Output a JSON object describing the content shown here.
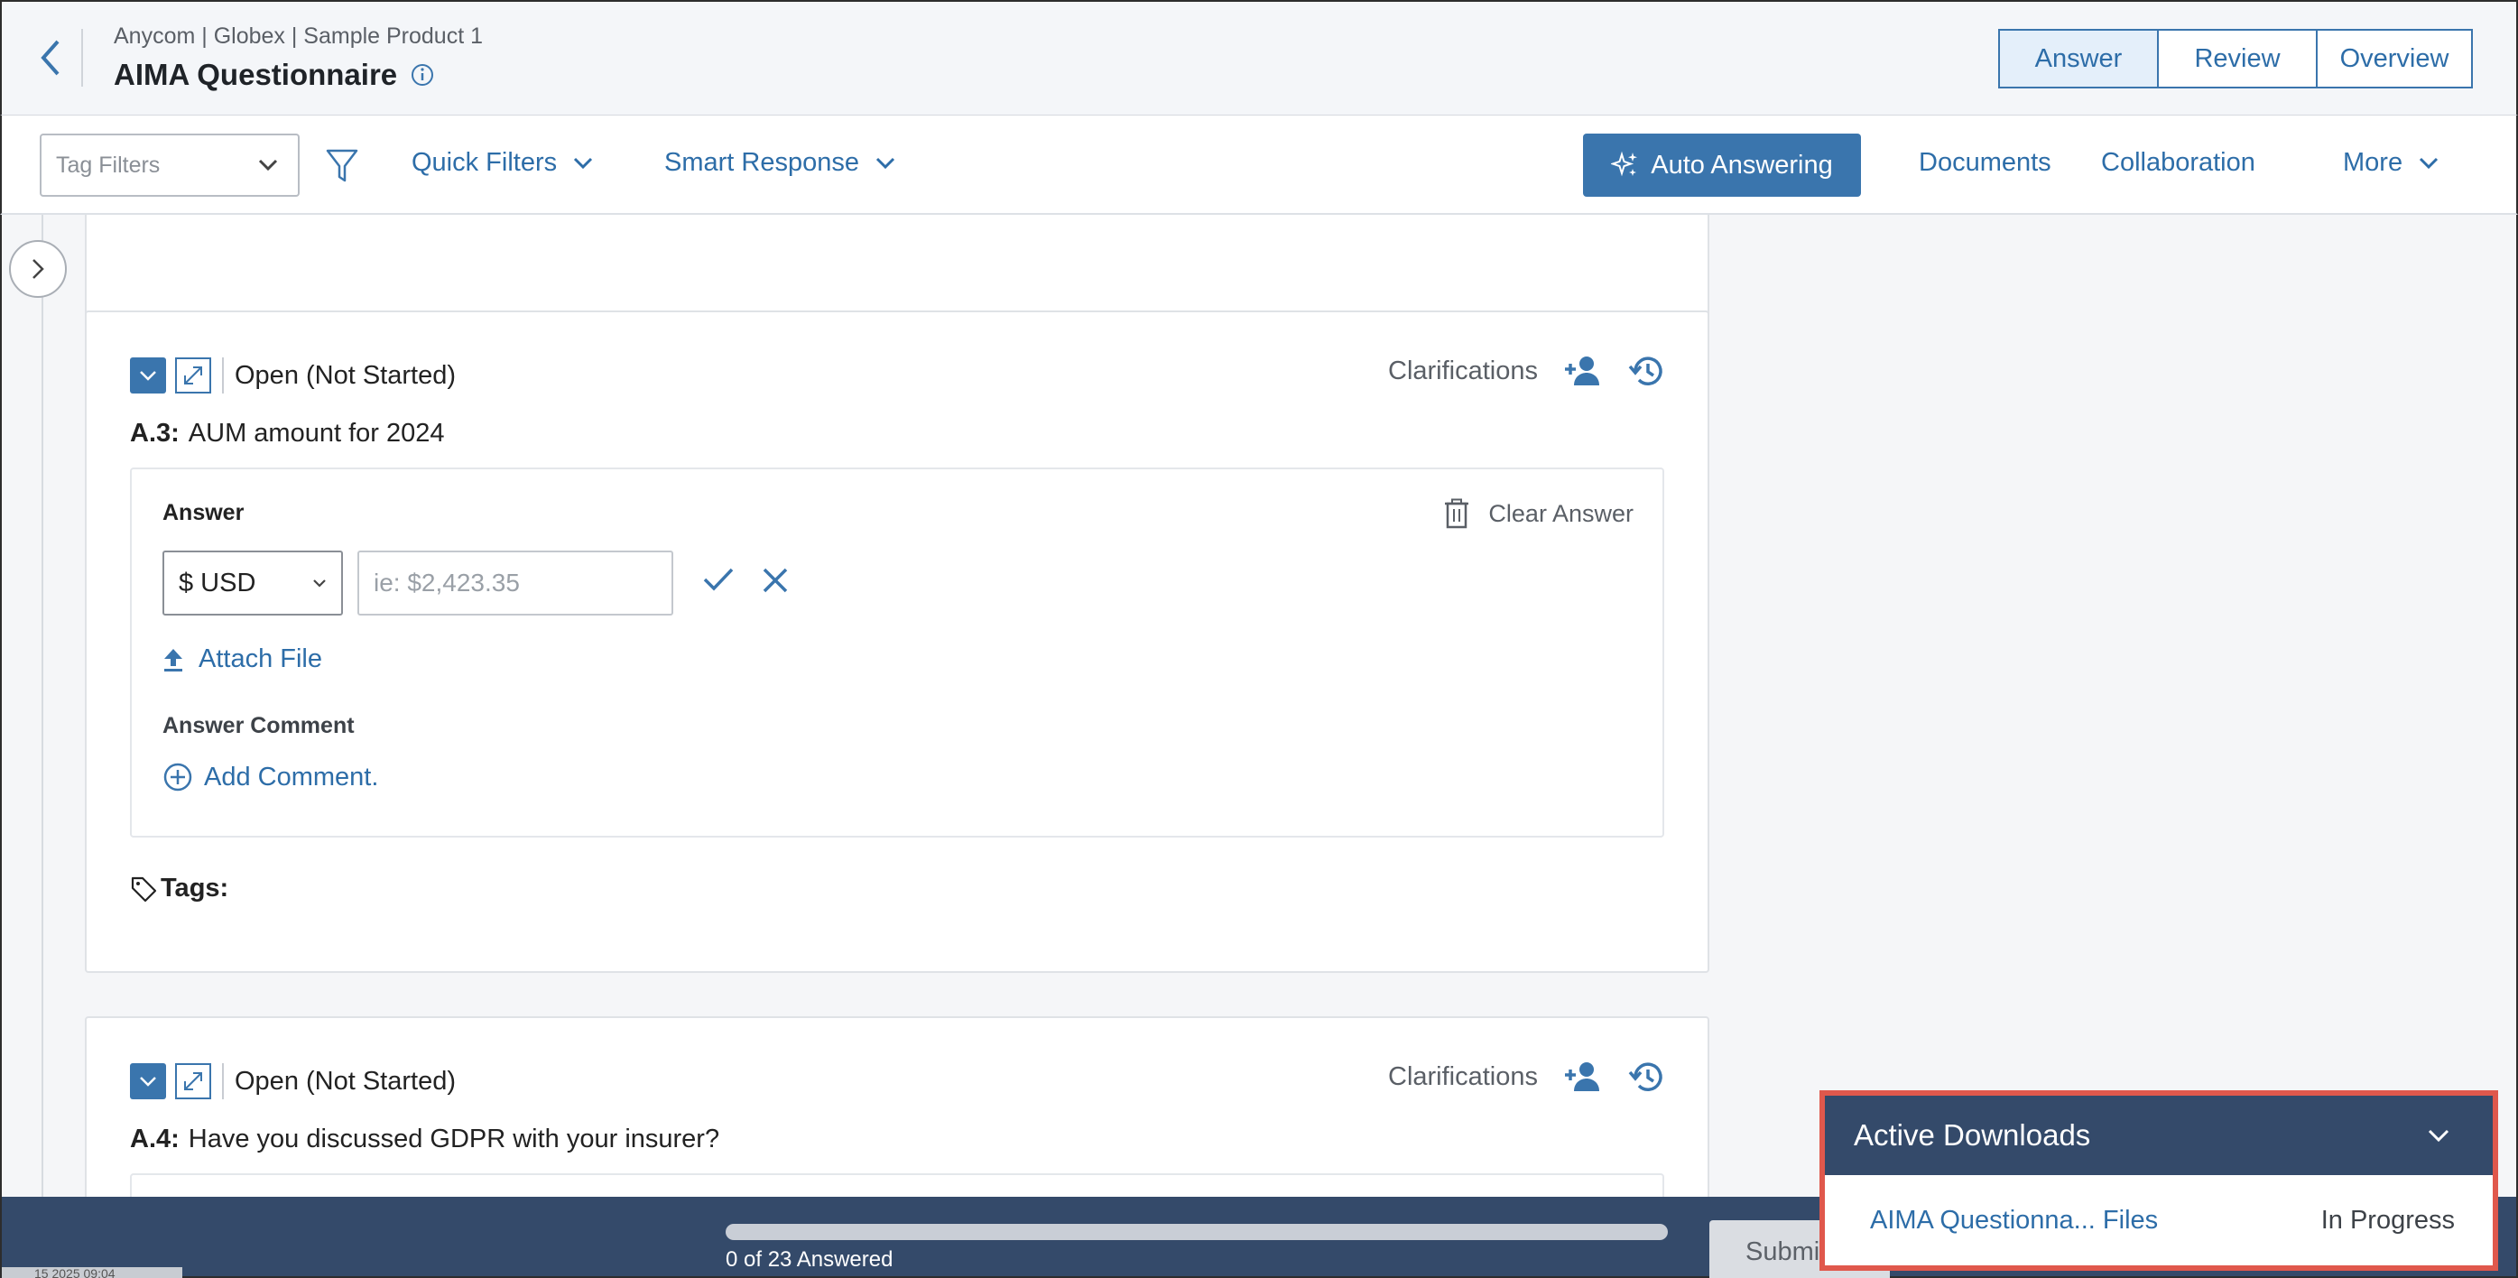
{
  "header": {
    "breadcrumb": "Anycom | Globex | Sample Product 1",
    "title": "AIMA Questionnaire",
    "views": [
      "Answer",
      "Review",
      "Overview"
    ]
  },
  "toolbar": {
    "tag_filter_placeholder": "Tag Filters",
    "quick_filters": "Quick Filters",
    "smart_response": "Smart Response",
    "auto_answering": "Auto Answering",
    "documents": "Documents",
    "collaboration": "Collaboration",
    "more": "More"
  },
  "questions": [
    {
      "status": "Open (Not Started)",
      "clarifications": "Clarifications",
      "id": "A.3:",
      "text": "AUM amount for 2024",
      "answer_label": "Answer",
      "clear_answer": "Clear Answer",
      "currency": "$ USD",
      "amount_placeholder": "ie: $2,423.35",
      "attach_file": "Attach File",
      "comment_label": "Answer Comment",
      "add_comment": "Add Comment.",
      "tags_label": "Tags:"
    },
    {
      "status": "Open (Not Started)",
      "clarifications": "Clarifications",
      "id": "A.4:",
      "text": "Have you discussed GDPR with your insurer?"
    }
  ],
  "footer": {
    "progress_label": "0 of 23 Answered",
    "progress_fraction": 0,
    "submit": "Submit",
    "timestamp": "15 2025 09:04"
  },
  "downloads": {
    "title": "Active Downloads",
    "items": [
      {
        "name": "AIMA Questionna... Files",
        "status": "In Progress"
      }
    ]
  },
  "colors": {
    "accent": "#3a75ad",
    "link": "#2d6da8",
    "footer": "#344a6a",
    "highlight": "#e0584c"
  }
}
